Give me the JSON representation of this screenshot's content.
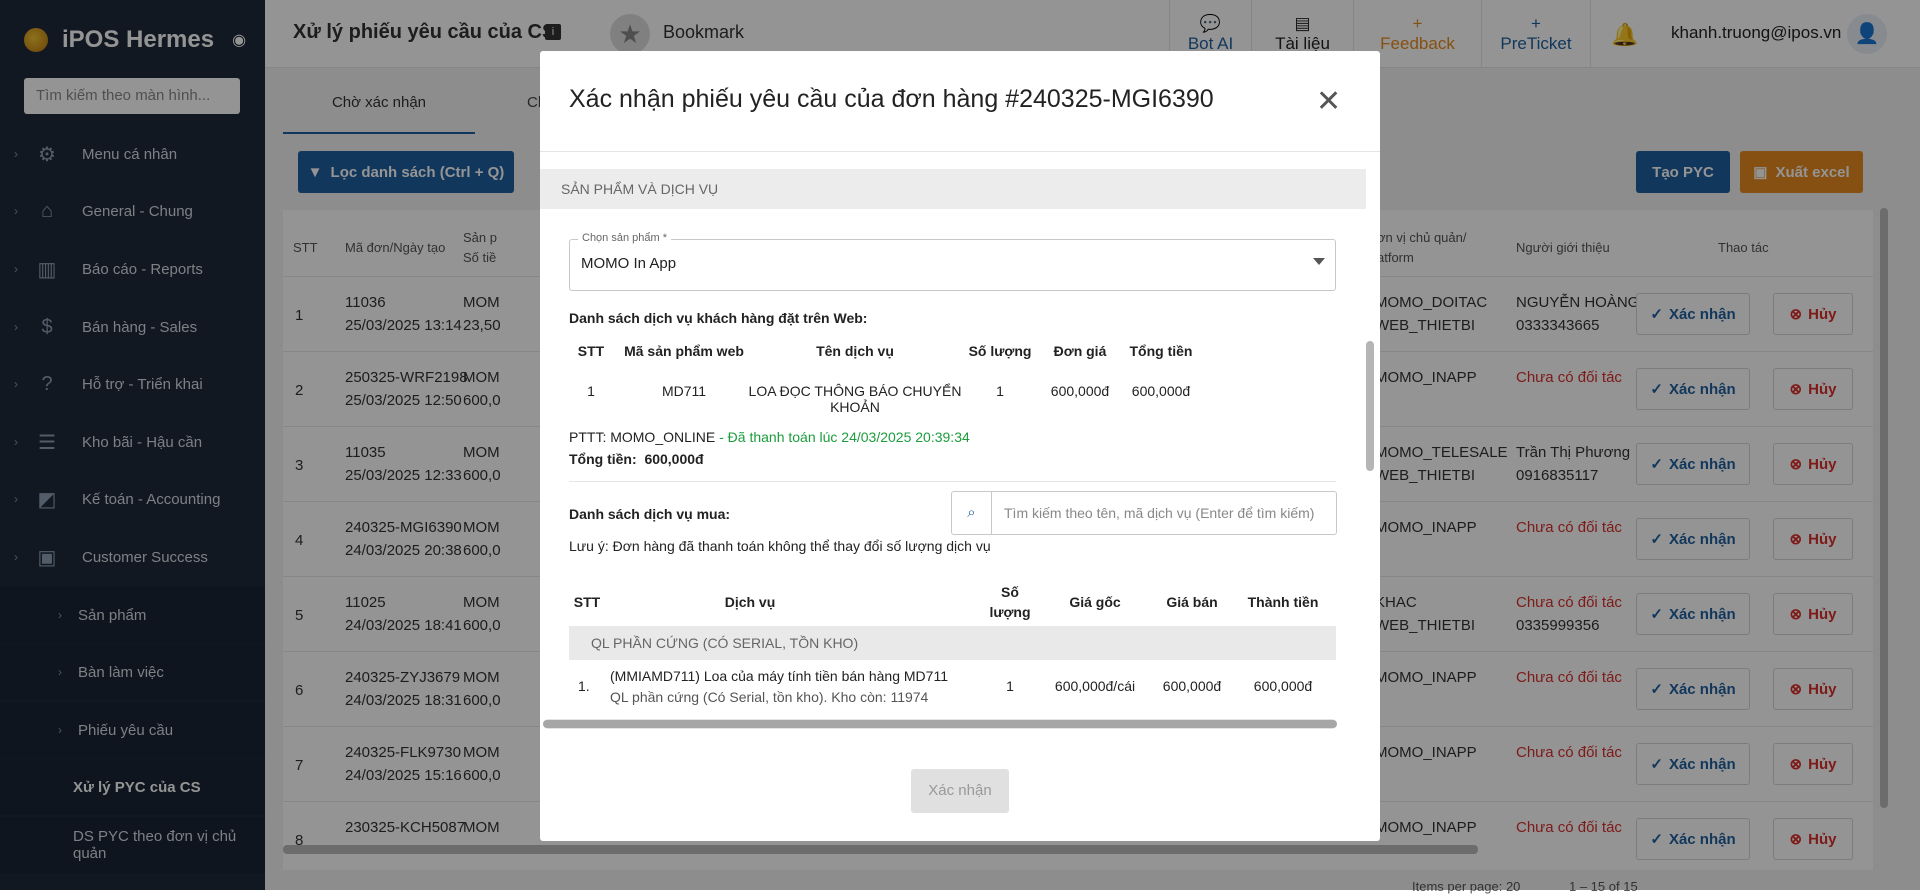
{
  "sidebar": {
    "brand": "iPOS Hermes",
    "search_placeholder": "Tìm kiếm theo màn hình...",
    "items": [
      {
        "label": "Menu cá nhân",
        "icon": "gear-icon"
      },
      {
        "label": "General - Chung",
        "icon": "home-icon"
      },
      {
        "label": "Báo cáo - Reports",
        "icon": "chart-icon"
      },
      {
        "label": "Bán hàng - Sales",
        "icon": "dollar-icon"
      },
      {
        "label": "Hỗ trợ - Triển khai",
        "icon": "help-icon"
      },
      {
        "label": "Kho bãi - Hậu cần",
        "icon": "warehouse-icon"
      },
      {
        "label": "Kế toán - Accounting",
        "icon": "accounting-icon"
      },
      {
        "label": "Customer Success",
        "icon": "customer-icon"
      }
    ],
    "sub_items": [
      {
        "label": "Sản phẩm"
      },
      {
        "label": "Bàn làm việc"
      },
      {
        "label": "Phiếu yêu cầu"
      },
      {
        "label": "Xử lý PYC của CS"
      },
      {
        "label": "DS PYC theo đơn vị chủ quản"
      }
    ]
  },
  "header": {
    "title": "Xử lý phiếu yêu cầu của CS",
    "bookmark": "Bookmark",
    "bot_ai": "Bot AI",
    "tai_lieu": "Tài liệu",
    "feedback": "Feedback",
    "preticket": "PreTicket",
    "email": "khanh.truong@ipos.vn"
  },
  "main": {
    "tabs": [
      "Chờ xác nhận",
      "Ch"
    ],
    "filter_button": "Lọc danh sách (Ctrl + Q)",
    "create_button": "Tạo PYC",
    "excel_button": "Xuất excel",
    "columns": {
      "stt": "STT",
      "ma_don": "Mã đơn/Ngày tạo",
      "san_pham_1": "Sản p",
      "san_pham_2": "Số tiề",
      "don_vi_1": "ơn vị chủ quản/",
      "don_vi_2": "atform",
      "nguoi_gioi_thieu": "Người giới thiệu",
      "thao_tac": "Thao tác"
    },
    "rows": [
      {
        "stt": "1",
        "code": "11036",
        "date": "25/03/2025 13:14",
        "product": "MOM",
        "amount": "23,50",
        "unit": "MOMO_DOITAC",
        "platform": "WEB_THIETBI",
        "ref": "NGUYỄN HOÀNG",
        "ref2": "0333343665",
        "ref_red": false
      },
      {
        "stt": "2",
        "code": "250325-WRF2198",
        "date": "25/03/2025 12:50",
        "product": "MOM",
        "amount": "600,0",
        "unit": "MOMO_INAPP",
        "platform": "",
        "ref": "Chưa có đối tác",
        "ref2": "",
        "ref_red": true
      },
      {
        "stt": "3",
        "code": "11035",
        "date": "25/03/2025 12:33",
        "product": "MOM",
        "amount": "600,0",
        "unit": "MOMO_TELESALE",
        "platform": "WEB_THIETBI",
        "ref": "Trần Thị Phương",
        "ref2": "0916835117",
        "ref_red": false
      },
      {
        "stt": "4",
        "code": "240325-MGI6390",
        "date": "24/03/2025 20:38",
        "product": "MOM",
        "amount": "600,0",
        "unit": "MOMO_INAPP",
        "platform": "",
        "ref": "Chưa có đối tác",
        "ref2": "",
        "ref_red": true
      },
      {
        "stt": "5",
        "code": "11025",
        "date": "24/03/2025 18:41",
        "product": "MOM",
        "amount": "600,0",
        "unit": "KHAC",
        "platform": "WEB_THIETBI",
        "ref": "Chưa có đối tác",
        "ref2": "0335999356",
        "ref_red": true
      },
      {
        "stt": "6",
        "code": "240325-ZYJ3679",
        "date": "24/03/2025 18:31",
        "product": "MOM",
        "amount": "600,0",
        "unit": "MOMO_INAPP",
        "platform": "",
        "ref": "Chưa có đối tác",
        "ref2": "",
        "ref_red": true
      },
      {
        "stt": "7",
        "code": "240325-FLK9730",
        "date": "24/03/2025 15:16",
        "product": "MOM",
        "amount": "600,0",
        "unit": "MOMO_INAPP",
        "platform": "",
        "ref": "Chưa có đối tác",
        "ref2": "",
        "ref_red": true
      },
      {
        "stt": "8",
        "code": "230325-KCH5087",
        "date": "",
        "product": "MOM",
        "amount": "",
        "unit": "MOMO_INAPP",
        "platform": "",
        "ref": "Chưa có đối tác",
        "ref2": "",
        "ref_red": true
      }
    ],
    "confirm_label": "Xác nhận",
    "cancel_label": "Hủy",
    "pager": {
      "items_per_page": "Items per page:  20",
      "range": "1 – 15 of 15"
    }
  },
  "modal": {
    "title": "Xác nhận phiếu yêu cầu của đơn hàng #240325-MGI6390",
    "section_title": "SẢN PHẨM VÀ DỊCH VỤ",
    "product_label": "Chọn sản phẩm *",
    "product_value": "MOMO In App",
    "web_services_title": "Danh sách dịch vụ khách hàng đặt trên Web:",
    "web_cols": [
      "STT",
      "Mã sản phẩm web",
      "Tên dịch vụ",
      "Số lượng",
      "Đơn giá",
      "Tổng tiền"
    ],
    "web_row": [
      "1",
      "MD711",
      "LOA ĐỌC THÔNG BÁO CHUYỂN KHOẢN",
      "1",
      "600,000đ",
      "600,000đ"
    ],
    "payment": "PTTT: MOMO_ONLINE",
    "payment_status": " - Đã thanh toán lúc 24/03/2025 20:39:34",
    "total_label": "Tổng tiền:",
    "total_value": "600,000đ",
    "buy_title": "Danh sách dịch vụ mua:",
    "search_placeholder": "Tìm kiếm theo tên, mã dịch vụ (Enter để tìm kiếm)",
    "note": "Lưu ý: Đơn hàng đã thanh toán không thể thay đổi số lượng dịch vụ",
    "buy_cols": {
      "stt": "STT",
      "dich_vu": "Dịch vụ",
      "sl1": "Số",
      "sl2": "lượng",
      "goc": "Giá gốc",
      "ban": "Giá bán",
      "thanh": "Thành tiền"
    },
    "group": "QL PHẦN CỨNG (CÓ SERIAL, TỒN KHO)",
    "item": {
      "stt": "1.",
      "name": "(MMIAMD711) Loa của máy tính tiền bán hàng MD711",
      "desc": "QL phần cứng (Có Serial, tồn kho). Kho còn: 11974",
      "qty": "1",
      "base": "600,000đ/cái",
      "price": "600,000đ",
      "total": "600,000đ"
    },
    "confirm_button": "Xác nhận"
  }
}
